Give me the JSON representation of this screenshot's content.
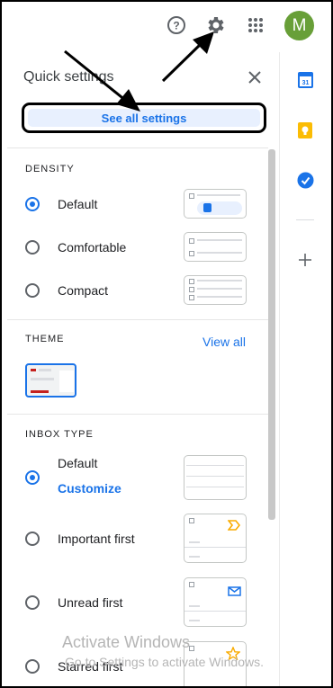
{
  "topbar": {
    "help_icon": "help-circle-icon",
    "settings_icon": "gear-icon",
    "apps_icon": "apps-grid-icon",
    "avatar_letter": "M",
    "avatar_color": "#689f38"
  },
  "quick_settings": {
    "title": "Quick settings",
    "close_icon": "close-icon",
    "see_all_label": "See all settings"
  },
  "density": {
    "title": "DENSITY",
    "options": [
      {
        "label": "Default",
        "selected": true
      },
      {
        "label": "Comfortable",
        "selected": false
      },
      {
        "label": "Compact",
        "selected": false
      }
    ]
  },
  "theme": {
    "title": "THEME",
    "view_all": "View all"
  },
  "inbox_type": {
    "title": "INBOX TYPE",
    "customize": "Customize",
    "options": [
      {
        "label": "Default",
        "selected": true
      },
      {
        "label": "Important first",
        "selected": false
      },
      {
        "label": "Unread first",
        "selected": false
      },
      {
        "label": "Starred first",
        "selected": false
      }
    ]
  },
  "side_panel": {
    "apps": [
      "calendar-icon",
      "keep-icon",
      "tasks-icon",
      "add-icon"
    ]
  },
  "watermark": {
    "line1": "Activate Windows",
    "line2": "Go to Settings to activate Windows."
  },
  "colors": {
    "accent": "#1a73e8",
    "avatar": "#689f38"
  }
}
